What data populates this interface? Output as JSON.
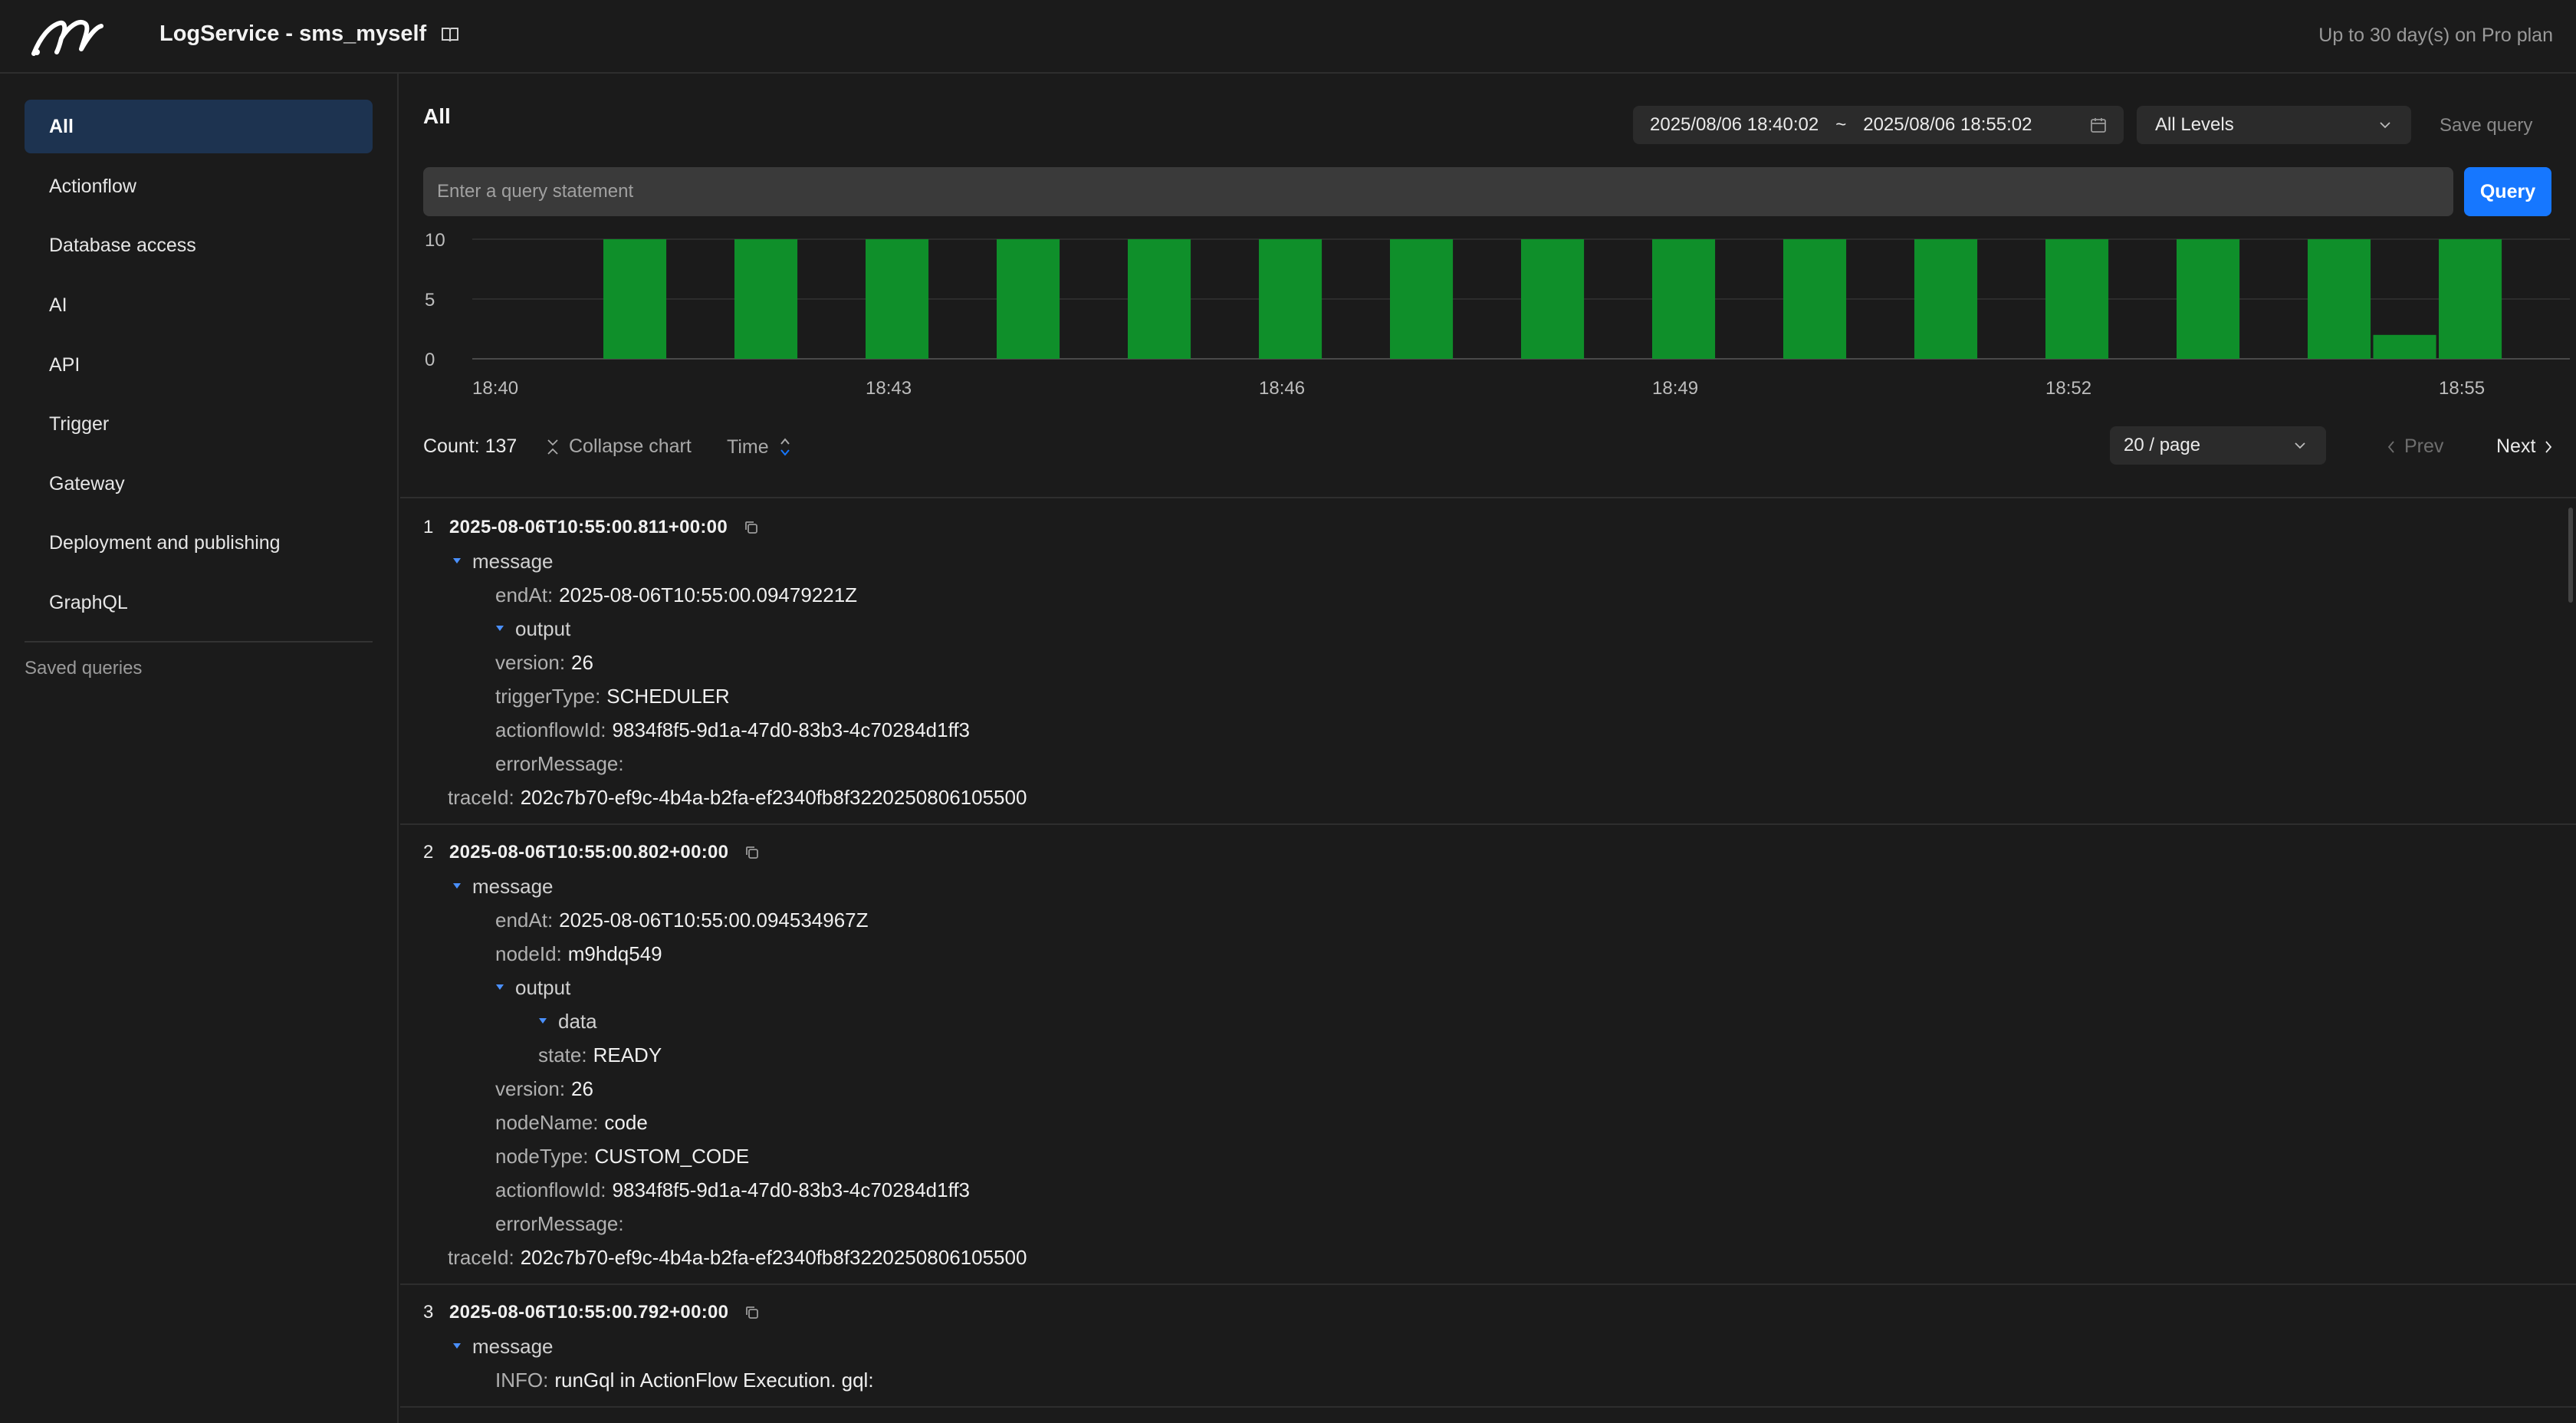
{
  "app": {
    "title": "LogService - sms_myself",
    "plan_note": "Up to 30 day(s) on Pro plan"
  },
  "sidebar": {
    "items": [
      {
        "label": "All"
      },
      {
        "label": "Actionflow"
      },
      {
        "label": "Database access"
      },
      {
        "label": "AI"
      },
      {
        "label": "API"
      },
      {
        "label": "Trigger"
      },
      {
        "label": "Gateway"
      },
      {
        "label": "Deployment and publishing"
      },
      {
        "label": "GraphQL"
      }
    ],
    "saved_label": "Saved queries"
  },
  "main": {
    "title": "All",
    "date_from": "2025/08/06 18:40:02",
    "date_sep": "~",
    "date_to": "2025/08/06 18:55:02",
    "level": "All Levels",
    "save_query": "Save query",
    "query_placeholder": "Enter a query statement",
    "query_button": "Query",
    "count": "Count: 137",
    "collapse": "Collapse chart",
    "sort": "Time",
    "page_size": "20 / page",
    "prev": "Prev",
    "next": "Next"
  },
  "colors": {
    "accent": "#1677ff",
    "bar": "#0f8f2a",
    "sidebar_active": "#1d3350"
  },
  "chart_data": {
    "type": "bar",
    "x": [
      0.0,
      0.5,
      1.0,
      1.5,
      2.0,
      2.5,
      3.0,
      3.5,
      4.0,
      4.5,
      5.0,
      5.5,
      6.0,
      6.5,
      7.0,
      7.5,
      8.0,
      8.5,
      9.0,
      9.5,
      10.0,
      10.5,
      11.0,
      11.5,
      12.0,
      12.5,
      13.0,
      13.5,
      14.0,
      14.5,
      15.0,
      15.5
    ],
    "values": [
      0,
      0,
      10,
      0,
      10,
      0,
      10,
      0,
      10,
      0,
      10,
      0,
      10,
      0,
      10,
      0,
      10,
      0,
      10,
      0,
      10,
      0,
      10,
      0,
      10,
      0,
      10,
      0,
      10,
      2,
      10,
      0
    ],
    "tick_labels": [
      "18:40",
      "18:43",
      "18:46",
      "18:49",
      "18:52",
      "18:55"
    ],
    "tick_positions": [
      0,
      3,
      6,
      9,
      12,
      15
    ],
    "yticks": [
      0,
      5,
      10
    ],
    "ylim": [
      0,
      10
    ],
    "grid": true
  },
  "logs": [
    {
      "index": "1",
      "time": "2025-08-06T10:55:00.811+00:00",
      "lines": [
        {
          "level": 1,
          "caret": true,
          "key": "message",
          "val": ""
        },
        {
          "level": 2,
          "key": "endAt:",
          "val": "2025-08-06T10:55:00.09479221Z"
        },
        {
          "level": 2,
          "caret": true,
          "key": "output",
          "val": ""
        },
        {
          "level": 2,
          "key": "version:",
          "val": "26"
        },
        {
          "level": 2,
          "key": "triggerType:",
          "val": "SCHEDULER"
        },
        {
          "level": 2,
          "key": "actionflowId:",
          "val": "9834f8f5-9d1a-47d0-83b3-4c70284d1ff3"
        },
        {
          "level": 2,
          "key": "errorMessage:",
          "val": ""
        },
        {
          "level": 0,
          "key": "traceId:",
          "val": "202c7b70-ef9c-4b4a-b2fa-ef2340fb8f3220250806105500"
        }
      ]
    },
    {
      "index": "2",
      "time": "2025-08-06T10:55:00.802+00:00",
      "lines": [
        {
          "level": 1,
          "caret": true,
          "key": "message",
          "val": ""
        },
        {
          "level": 2,
          "key": "endAt:",
          "val": "2025-08-06T10:55:00.094534967Z"
        },
        {
          "level": 2,
          "key": "nodeId:",
          "val": "m9hdq549"
        },
        {
          "level": 2,
          "caret": true,
          "key": "output",
          "val": ""
        },
        {
          "level": 3,
          "caret": true,
          "key": "data",
          "val": ""
        },
        {
          "level": 3,
          "key": "state:",
          "val": "READY"
        },
        {
          "level": 2,
          "key": "version:",
          "val": "26"
        },
        {
          "level": 2,
          "key": "nodeName:",
          "val": "code"
        },
        {
          "level": 2,
          "key": "nodeType:",
          "val": "CUSTOM_CODE"
        },
        {
          "level": 2,
          "key": "actionflowId:",
          "val": "9834f8f5-9d1a-47d0-83b3-4c70284d1ff3"
        },
        {
          "level": 2,
          "key": "errorMessage:",
          "val": ""
        },
        {
          "level": 0,
          "key": "traceId:",
          "val": "202c7b70-ef9c-4b4a-b2fa-ef2340fb8f3220250806105500"
        }
      ]
    },
    {
      "index": "3",
      "time": "2025-08-06T10:55:00.792+00:00",
      "lines": [
        {
          "level": 1,
          "caret": true,
          "key": "message",
          "val": ""
        },
        {
          "level": 2,
          "key": "INFO:",
          "val": "runGql in ActionFlow Execution. gql:"
        }
      ]
    }
  ]
}
